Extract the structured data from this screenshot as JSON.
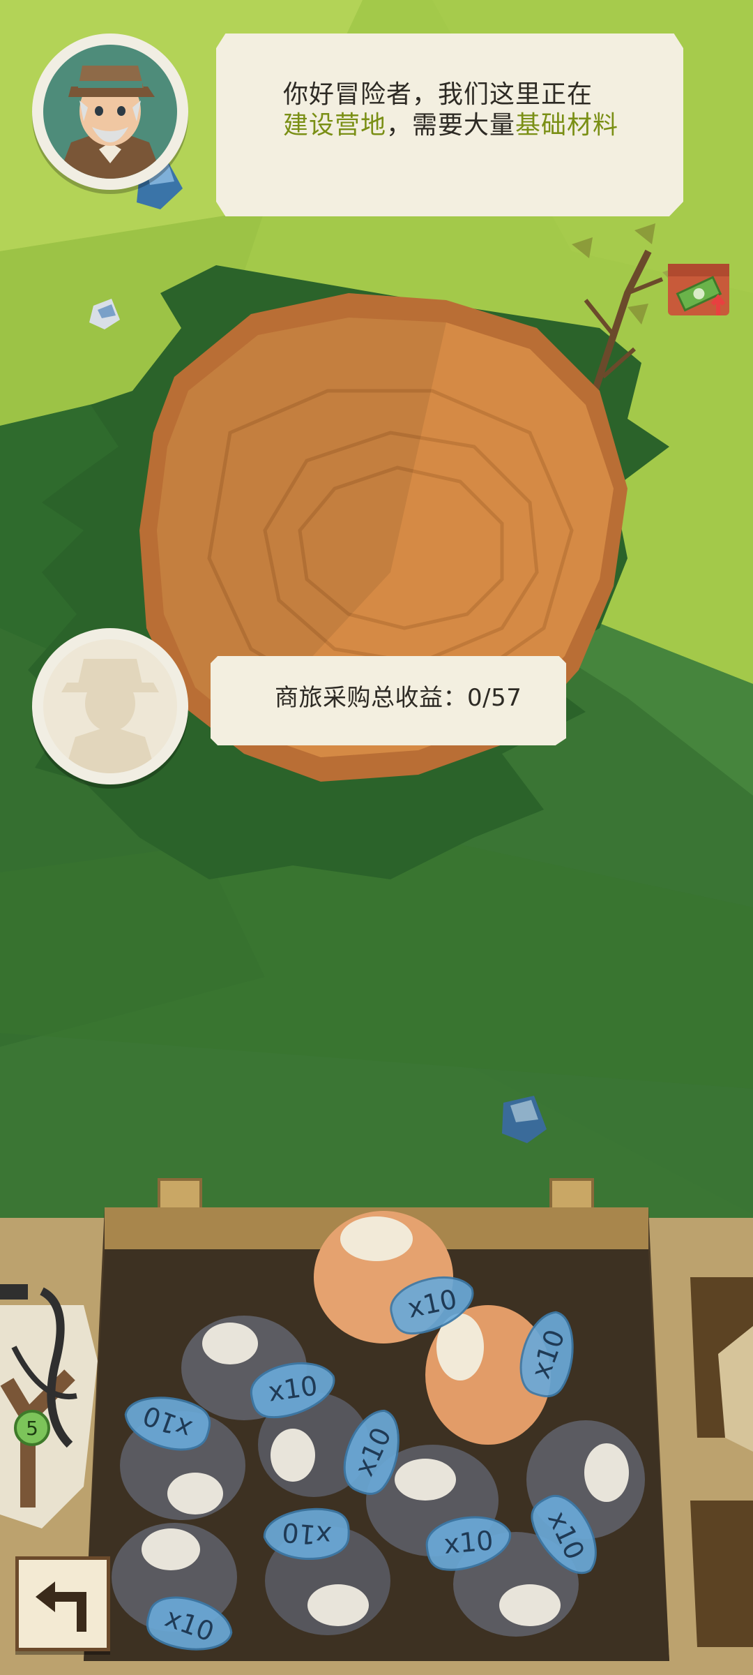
{
  "npc_dialog": {
    "line_prefix": "你好冒险者，我们这里正在",
    "highlight_1": "建设营地",
    "line_middle": "，需要大量",
    "highlight_2": "基础材料"
  },
  "income": {
    "text": "商旅采购总收益：0/57"
  },
  "crate": {
    "item_multiplier_label": "x10"
  },
  "slingshot": {
    "ammo_count": "5"
  },
  "icons": {
    "back": "back-arrow-icon",
    "shop": "cash-upgrade-icon",
    "npc": "old-man-portrait-icon",
    "player": "adventurer-silhouette-icon"
  }
}
